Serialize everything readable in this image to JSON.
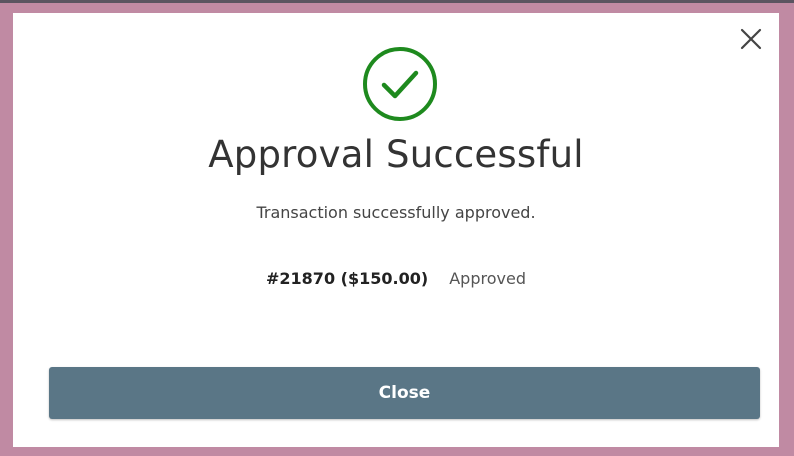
{
  "dialog": {
    "title": "Approval Successful",
    "message": "Transaction successfully approved.",
    "transaction": {
      "id_amount": "#21870 ($150.00)",
      "status": "Approved"
    },
    "close_button_label": "Close",
    "icons": {
      "dismiss": "close-icon",
      "status": "checkmark-circle-icon"
    }
  },
  "colors": {
    "success_green": "#1e8a1e",
    "button_bg": "#5a7686",
    "backdrop": "#c08aa3"
  }
}
